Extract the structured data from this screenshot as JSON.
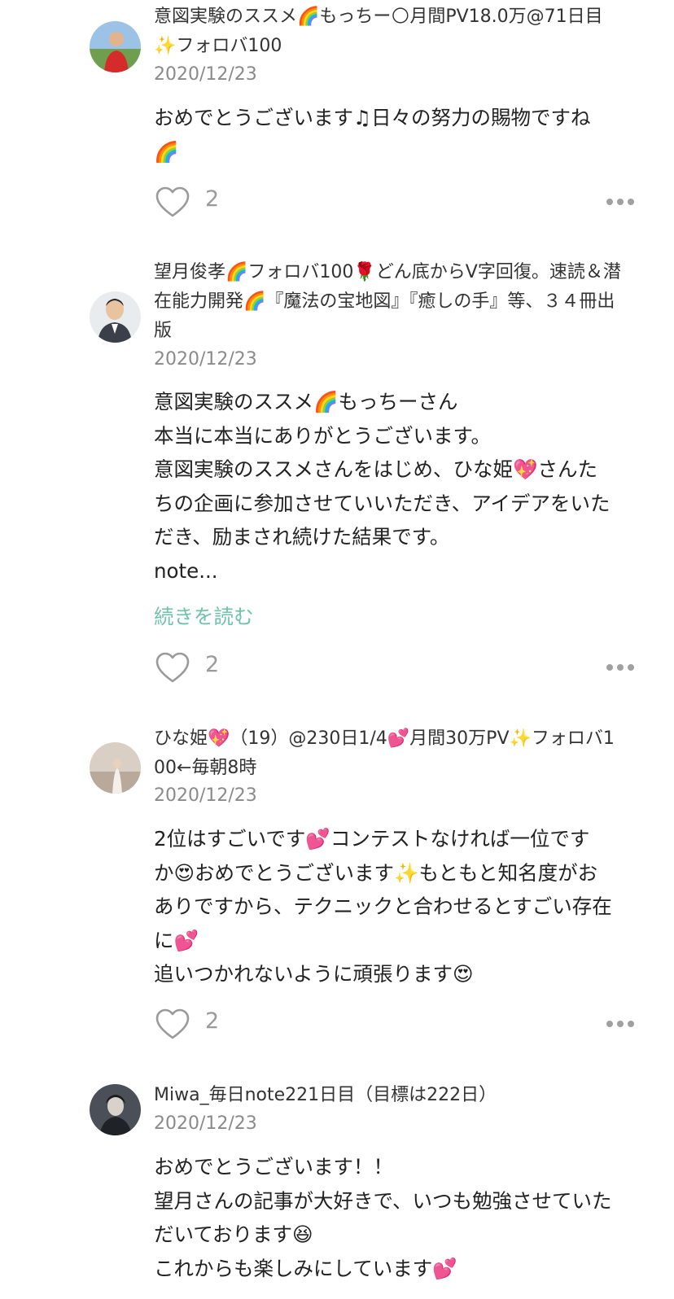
{
  "comments": [
    {
      "name_lines": [
        "意図実験のススメ🌈もっちー🌕月間PV18.0万@71日目",
        "✨フォロバ100"
      ],
      "date": "2020/12/23",
      "body_lines": [
        "おめでとうございます♫日々の努力の賜物ですね",
        "🌈"
      ],
      "read_more": "",
      "likes": "2"
    },
    {
      "name_lines": [
        "望月俊孝🌈フォロバ100🌹どん底からV字回復。速読＆潜",
        "在能力開発🌈『魔法の宝地図』『癒しの手』等、３４冊出",
        "版"
      ],
      "date": "2020/12/23",
      "body_lines": [
        "意図実験のススメ🌈もっちーさん",
        "本当に本当にありがとうございます。",
        "意図実験のススメさんをはじめ、ひな姫💖さんた",
        "ちの企画に参加させていいただき、アイデアをいた",
        "だき、励まされ続けた結果です。",
        "note..."
      ],
      "read_more": "続きを読む",
      "likes": "2"
    },
    {
      "name_lines": [
        "ひな姫💖（19）@230日1/4💕月間30万PV✨フォロバ1",
        "00←毎朝8時"
      ],
      "date": "2020/12/23",
      "body_lines": [
        "2位はすごいです💕コンテストなければ一位です",
        "か😍おめでとうございます✨もともと知名度がお",
        "ありですから、テクニックと合わせるとすごい存在",
        "に💕",
        "追いつかれないように頑張ります😍"
      ],
      "read_more": "",
      "likes": "2"
    },
    {
      "name_lines": [
        "Miwa_毎日note221日目（目標は222日）"
      ],
      "date": "2020/12/23",
      "body_lines": [
        "おめでとうございます！！",
        "望月さんの記事が大好きで、いつも勉強させていた",
        "だいております😆",
        "これからも楽しみにしています💕"
      ],
      "read_more": "",
      "likes": ""
    }
  ]
}
